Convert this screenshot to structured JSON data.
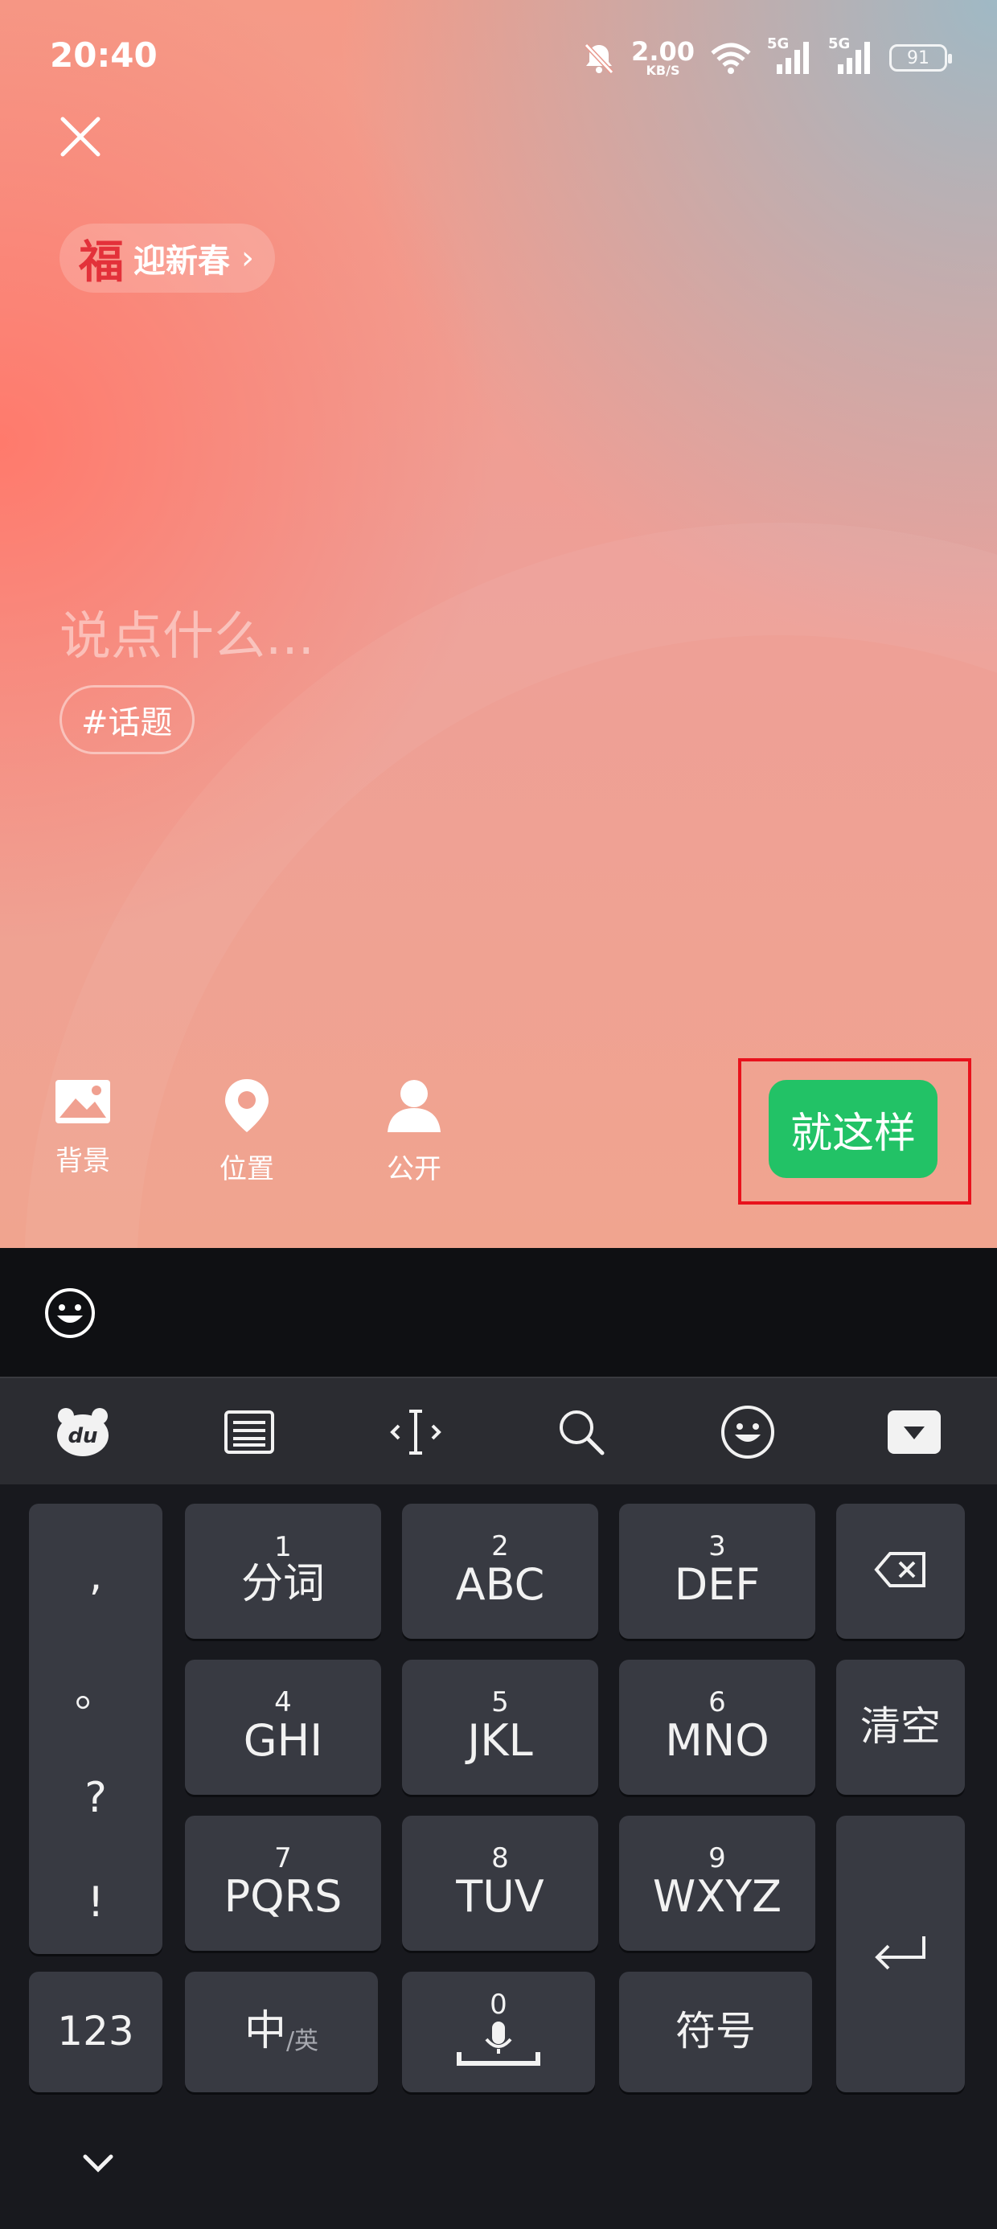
{
  "status_bar": {
    "time": "20:40",
    "net_speed": "2.00",
    "net_unit": "KB/S",
    "signal1": "5G",
    "signal2": "5G",
    "battery": "91"
  },
  "compose": {
    "topic_chip": {
      "icon": "福",
      "label": "迎新春",
      "chevron": "›"
    },
    "placeholder": "说点什么...",
    "hashtag": "#话题",
    "tools": [
      {
        "label": "背景",
        "icon": "image-icon"
      },
      {
        "label": "位置",
        "icon": "location-pin-icon"
      },
      {
        "label": "公开",
        "icon": "person-icon"
      }
    ],
    "done_button": "就这样",
    "accent": "#22c266",
    "highlight": "#e8121c"
  },
  "keyboard": {
    "punctuation": [
      ",",
      "。",
      "?",
      "!"
    ],
    "keys": [
      {
        "num": "1",
        "main": "分词"
      },
      {
        "num": "2",
        "main": "ABC"
      },
      {
        "num": "3",
        "main": "DEF"
      },
      {
        "num": "4",
        "main": "GHI"
      },
      {
        "num": "5",
        "main": "JKL"
      },
      {
        "num": "6",
        "main": "MNO"
      },
      {
        "num": "7",
        "main": "PQRS"
      },
      {
        "num": "8",
        "main": "TUV"
      },
      {
        "num": "9",
        "main": "WXYZ"
      }
    ],
    "clear": "清空",
    "numbers_key": "123",
    "lang_key_main": "中",
    "lang_key_sub": "/英",
    "space_num": "0",
    "symbols_key": "符号"
  }
}
